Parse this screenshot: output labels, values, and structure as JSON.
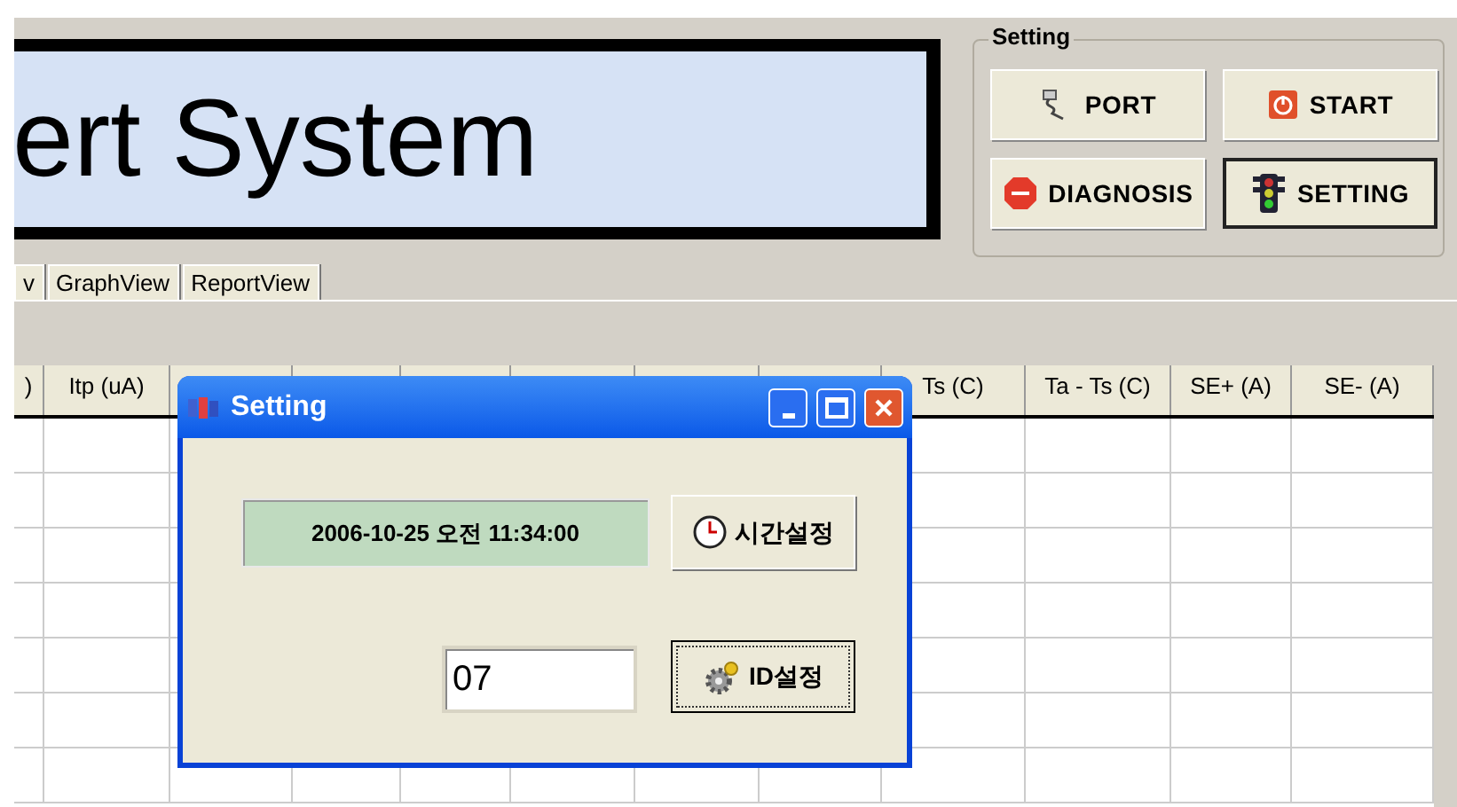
{
  "banner": {
    "title": "ert System"
  },
  "setting_group": {
    "title": "Setting",
    "buttons": [
      {
        "label": "PORT",
        "kind": "port",
        "selected": false
      },
      {
        "label": "START",
        "kind": "start",
        "selected": false
      },
      {
        "label": "DIAGNOSIS",
        "kind": "stop",
        "selected": false
      },
      {
        "label": "SETTING",
        "kind": "traffic",
        "selected": true
      }
    ]
  },
  "tabs": [
    {
      "label": "v",
      "selected": false
    },
    {
      "label": "GraphView",
      "selected": false
    },
    {
      "label": "ReportView",
      "selected": false
    }
  ],
  "table": {
    "columns": [
      {
        "label": ")"
      },
      {
        "label": "Itp (uA)"
      },
      {},
      {},
      {},
      {},
      {},
      {},
      {
        "label": "Ts (C)"
      },
      {
        "label": "Ta - Ts (C)"
      },
      {
        "label": "SE+ (A)"
      },
      {
        "label": "SE- (A)"
      }
    ]
  },
  "dialog": {
    "title": "Setting",
    "datetime": "2006-10-25 오전 11:34:00",
    "time_button": "시간설정",
    "id_value": "07",
    "id_button": "ID설정"
  }
}
